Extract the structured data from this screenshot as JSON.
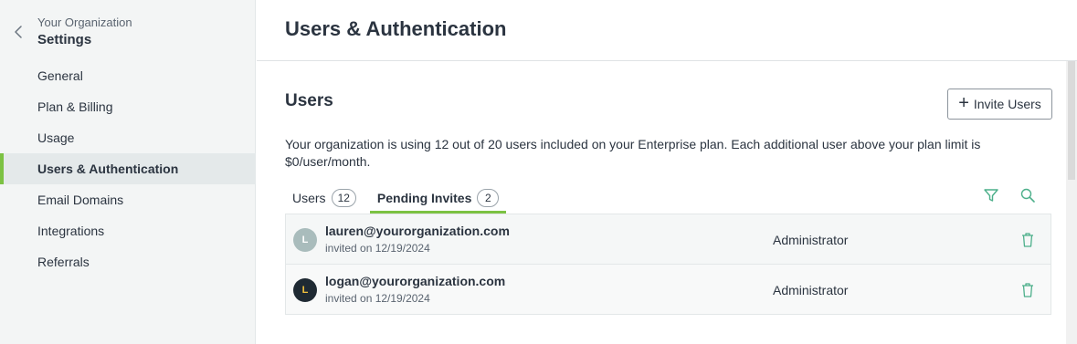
{
  "sidebar": {
    "org_name": "Your Organization",
    "title": "Settings",
    "back_icon": "chevron-left-icon",
    "items": [
      {
        "label": "General",
        "active": false
      },
      {
        "label": "Plan & Billing",
        "active": false
      },
      {
        "label": "Usage",
        "active": false
      },
      {
        "label": "Users & Authentication",
        "active": true
      },
      {
        "label": "Email Domains",
        "active": false
      },
      {
        "label": "Integrations",
        "active": false
      },
      {
        "label": "Referrals",
        "active": false
      }
    ]
  },
  "header": {
    "title": "Users & Authentication"
  },
  "users_section": {
    "title": "Users",
    "invite_button_label": "Invite Users",
    "info_text": "Your organization is using 12 out of 20 users included on your Enterprise plan. Each additional user above your plan limit is $0/user/month.",
    "tabs": [
      {
        "label": "Users",
        "count": "12",
        "active": false
      },
      {
        "label": "Pending Invites",
        "count": "2",
        "active": true
      }
    ],
    "invites": [
      {
        "avatar_letter": "L",
        "avatar_bg": "#a9bcbc",
        "avatar_fg": "#ffffff",
        "email": "lauren@yourorganization.com",
        "invited": "invited on 12/19/2024",
        "role": "Administrator"
      },
      {
        "avatar_letter": "L",
        "avatar_bg": "#1f2a33",
        "avatar_fg": "#f2c23d",
        "email": "logan@yourorganization.com",
        "invited": "invited on 12/19/2024",
        "role": "Administrator"
      }
    ]
  },
  "colors": {
    "accent": "#7cc243",
    "sidebar_bg": "#f3f5f5",
    "text": "#2b3440"
  }
}
